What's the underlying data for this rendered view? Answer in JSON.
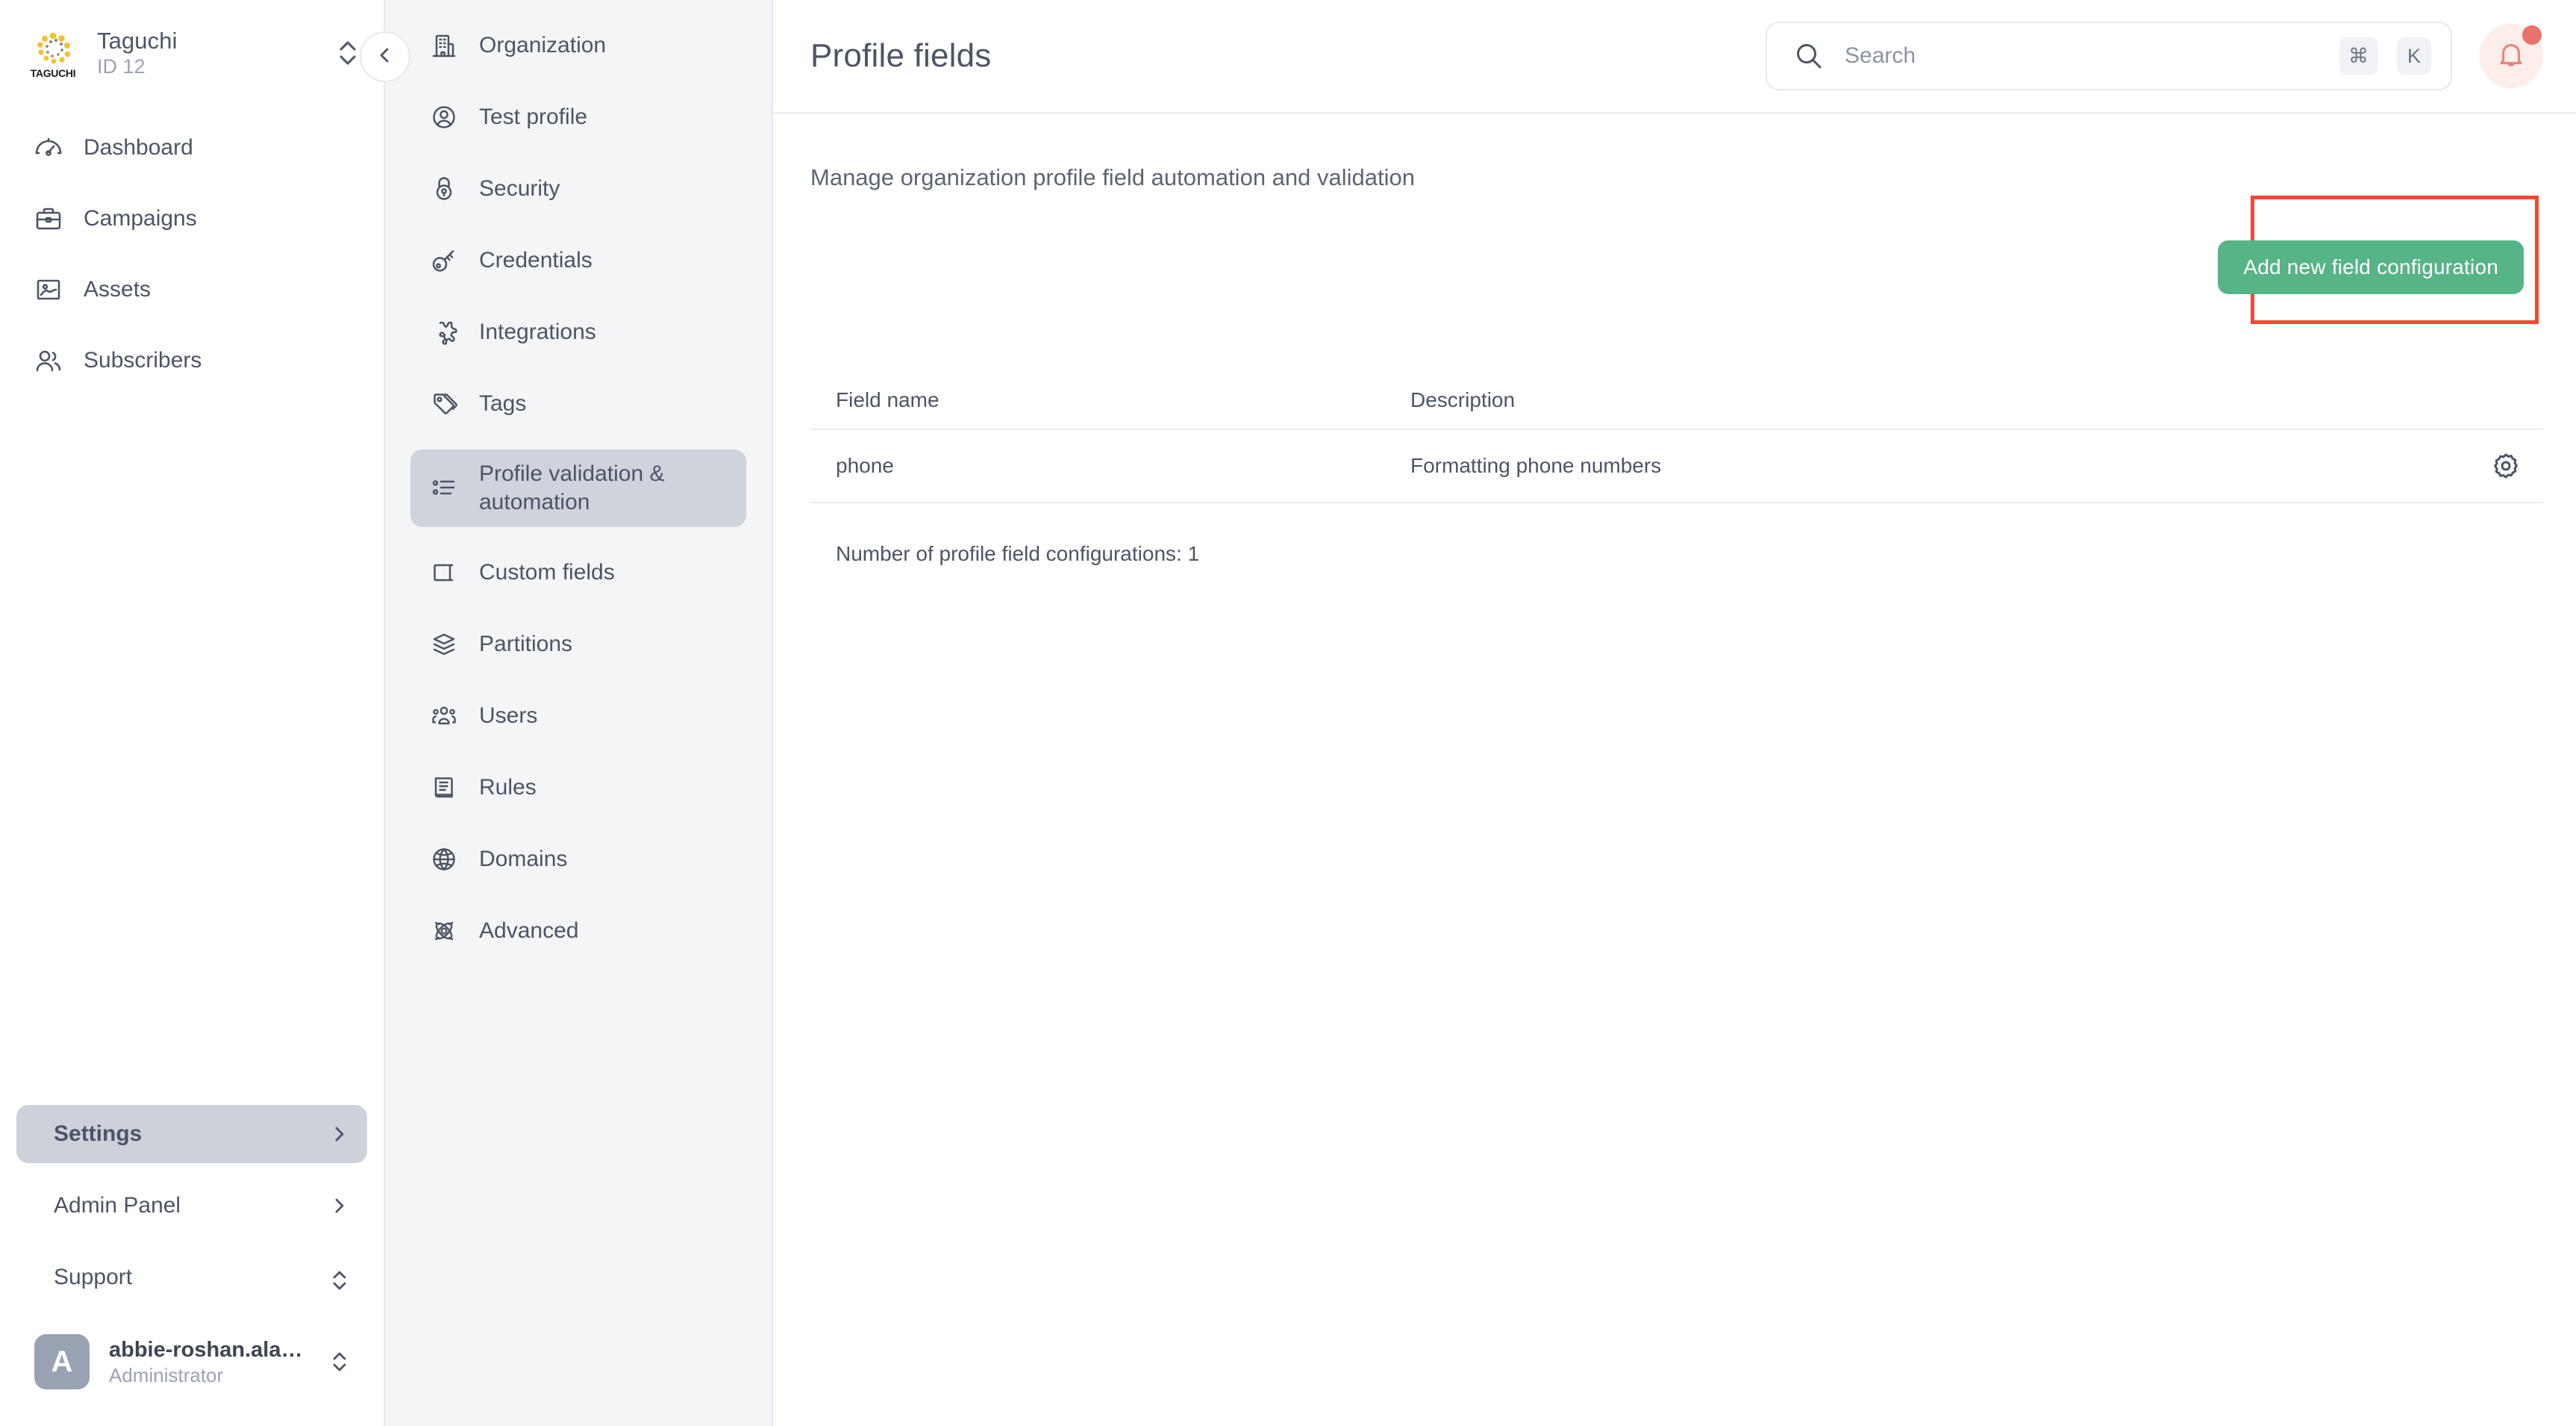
{
  "org": {
    "logo_text": "TAGUCHI",
    "name": "Taguchi",
    "id_label": "ID 12",
    "switcher_icon": "up-down-chevron-icon"
  },
  "primary_nav": {
    "items": [
      {
        "label": "Dashboard",
        "icon": "gauge-icon"
      },
      {
        "label": "Campaigns",
        "icon": "briefcase-icon"
      },
      {
        "label": "Assets",
        "icon": "image-icon"
      },
      {
        "label": "Subscribers",
        "icon": "people-icon"
      }
    ]
  },
  "sidebar_bottom": {
    "items": [
      {
        "label": "Settings",
        "icon": "gear-icon",
        "trailing": "chevron-right-icon",
        "active": true
      },
      {
        "label": "Admin Panel",
        "icon": "id-card-icon",
        "trailing": "chevron-right-icon",
        "active": false
      },
      {
        "label": "Support",
        "icon": "lifebuoy-icon",
        "trailing": "up-down-chevron-icon",
        "active": false
      }
    ],
    "user": {
      "avatar_initial": "A",
      "name": "abbie-roshan.alag...",
      "role": "Administrator",
      "trailing": "up-down-chevron-icon"
    }
  },
  "secondary_nav": {
    "collapse_icon": "chevron-left-icon",
    "items": [
      {
        "label": "Organization",
        "icon": "building-icon",
        "active": false
      },
      {
        "label": "Test profile",
        "icon": "user-circle-icon",
        "active": false
      },
      {
        "label": "Security",
        "icon": "lock-icon",
        "active": false
      },
      {
        "label": "Credentials",
        "icon": "key-icon",
        "active": false
      },
      {
        "label": "Integrations",
        "icon": "puzzle-icon",
        "active": false
      },
      {
        "label": "Tags",
        "icon": "tag-icon",
        "active": false
      },
      {
        "label": "Profile validation & automation",
        "icon": "list-icon",
        "active": true
      },
      {
        "label": "Custom fields",
        "icon": "text-field-icon",
        "active": false
      },
      {
        "label": "Partitions",
        "icon": "layers-icon",
        "active": false
      },
      {
        "label": "Users",
        "icon": "users-group-icon",
        "active": false
      },
      {
        "label": "Rules",
        "icon": "document-icon",
        "active": false
      },
      {
        "label": "Domains",
        "icon": "globe-icon",
        "active": false
      },
      {
        "label": "Advanced",
        "icon": "atom-icon",
        "active": false
      }
    ]
  },
  "header": {
    "title": "Profile fields",
    "search": {
      "placeholder": "Search",
      "value": "",
      "icon": "search-icon",
      "shortcut_modifier": "⌘",
      "shortcut_key": "K"
    },
    "notifications": {
      "icon": "bell-icon",
      "has_unread": true,
      "badge_color": "#e8736a",
      "background_color": "#fdeeea"
    }
  },
  "main": {
    "subtitle": "Manage organization profile field automation and validation",
    "add_button": {
      "label": "Add new field configuration",
      "color": "#56b486"
    },
    "highlight": {
      "color": "#f04a32"
    },
    "table": {
      "columns": [
        "Field name",
        "Description"
      ],
      "rows": [
        {
          "field_name": "phone",
          "description": "Formatting phone numbers",
          "action_icon": "gear-icon"
        }
      ]
    },
    "footer_text": "Number of profile field configurations: 1"
  }
}
